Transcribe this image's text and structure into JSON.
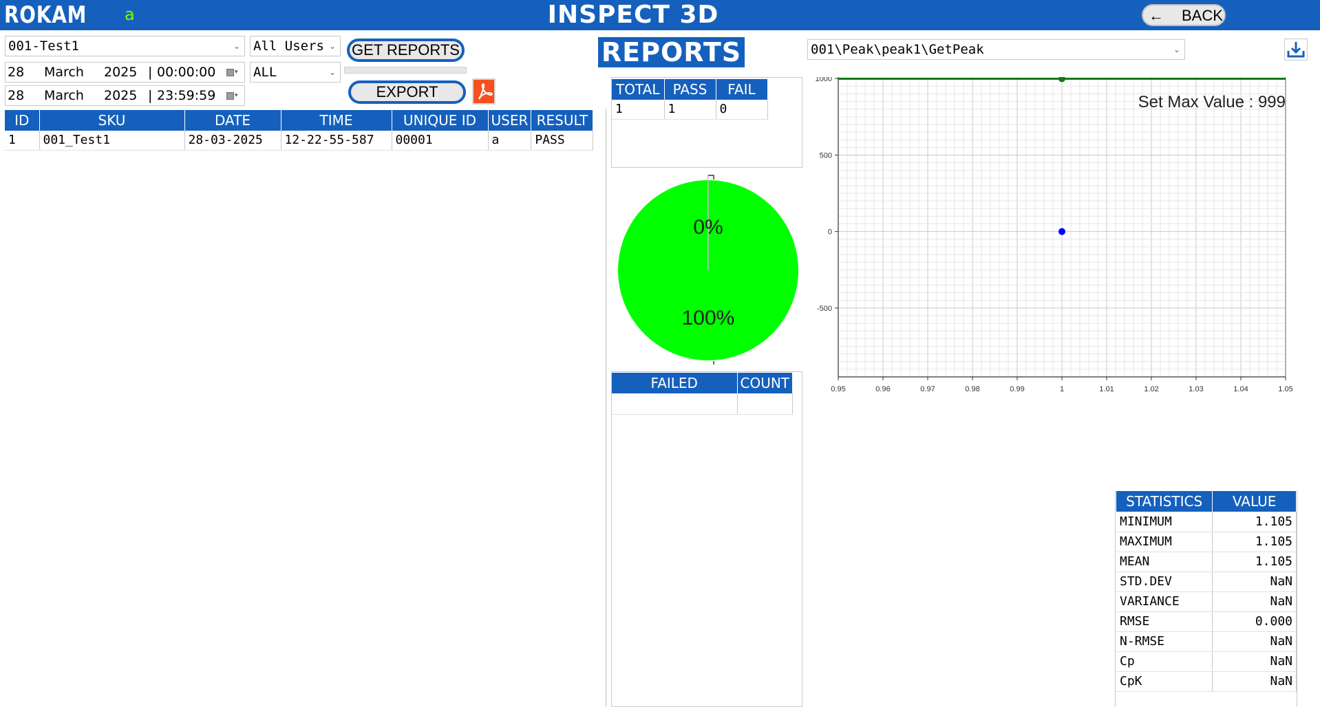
{
  "app": {
    "brand": "ROKAM",
    "current_user": "a",
    "title": "INSPECT 3D",
    "back_label": "BACK"
  },
  "filters": {
    "sku_selected": "001-Test1",
    "users_selected": "All Users",
    "result_selected": "ALL",
    "from": {
      "day": "28",
      "month": "March",
      "year": "2025",
      "time": "00:00:00"
    },
    "to": {
      "day": "28",
      "month": "March",
      "year": "2025",
      "time": "23:59:59"
    },
    "get_reports_label": "GET REPORTS",
    "export_label": "EXPORT",
    "progress": 0
  },
  "reports_table": {
    "columns": [
      "ID",
      "SKU",
      "DATE",
      "TIME",
      "UNIQUE ID",
      "USER",
      "RESULT"
    ],
    "rows": [
      [
        "1",
        "001_Test1",
        "28-03-2025",
        "12-22-55-587",
        "00001",
        "a",
        "PASS"
      ]
    ]
  },
  "reports_heading": "REPORTS",
  "summary": {
    "columns": [
      "TOTAL",
      "PASS",
      "FAIL"
    ],
    "values": [
      "1",
      "1",
      "0"
    ]
  },
  "pie": {
    "fail_label": "0%",
    "pass_label": "100%",
    "pass_fraction": 1.0,
    "pass_color": "#00ff00"
  },
  "failed_table": {
    "columns": [
      "FAILED",
      "COUNT"
    ],
    "rows": []
  },
  "measurement": {
    "selected": "001\\Peak\\peak1\\GetPeak"
  },
  "chart_data": {
    "type": "scatter",
    "annotation": "Set Max Value : 999",
    "x_ticks": [
      "0.95",
      "0.96",
      "0.97",
      "0.98",
      "0.99",
      "1",
      "1.01",
      "1.02",
      "1.03",
      "1.04",
      "1.05"
    ],
    "y_ticks": [
      "1000",
      "500",
      "0",
      "-500"
    ],
    "xlim": [
      0.95,
      1.05
    ],
    "ylim": [
      -950,
      1010
    ],
    "grid": true,
    "max_line": {
      "value": 999,
      "color": "#117a11"
    },
    "points": [
      {
        "x": 1,
        "y": 999,
        "color": "#117a11"
      },
      {
        "x": 1,
        "y": 0,
        "color": "#0000ff"
      }
    ]
  },
  "statistics": {
    "columns": [
      "STATISTICS",
      "VALUE"
    ],
    "rows": [
      [
        "MINIMUM",
        "1.105"
      ],
      [
        "MAXIMUM",
        "1.105"
      ],
      [
        "MEAN",
        "1.105"
      ],
      [
        "STD.DEV",
        "NaN"
      ],
      [
        "VARIANCE",
        "NaN"
      ],
      [
        "RMSE",
        "0.000"
      ],
      [
        "N-RMSE",
        "NaN"
      ],
      [
        "Cp",
        "NaN"
      ],
      [
        "CpK",
        "NaN"
      ]
    ]
  },
  "colors": {
    "primary": "#1560bd",
    "pass": "#00ff00",
    "user": "#7cfc00",
    "pdf": "#f4511e"
  }
}
